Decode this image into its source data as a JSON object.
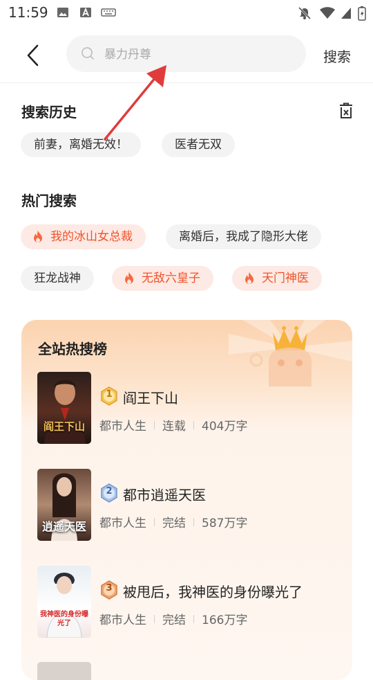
{
  "status_bar": {
    "time": "11:59"
  },
  "header": {
    "search_placeholder": "暴力丹尊",
    "search_button": "搜索"
  },
  "history": {
    "title": "搜索历史",
    "items": [
      "前妻，离婚无效！",
      "医者无双"
    ]
  },
  "hot": {
    "title": "热门搜索",
    "items": [
      {
        "label": "我的冰山女总裁",
        "hot": true
      },
      {
        "label": "离婚后，我成了隐形大佬",
        "hot": false
      },
      {
        "label": "狂龙战神",
        "hot": false
      },
      {
        "label": "无敌六皇子",
        "hot": true
      },
      {
        "label": "天门神医",
        "hot": true
      }
    ]
  },
  "ranking": {
    "title": "全站热搜榜",
    "books": [
      {
        "rank": "1",
        "title": "阎王下山",
        "genre": "都市人生",
        "status": "连载",
        "words": "404万字",
        "cover_text": "阎王下山"
      },
      {
        "rank": "2",
        "title": "都市逍遥天医",
        "genre": "都市人生",
        "status": "完结",
        "words": "587万字",
        "cover_text": "逍遥天医"
      },
      {
        "rank": "3",
        "title": "被甩后，我神医的身份曝光了",
        "genre": "都市人生",
        "status": "完结",
        "words": "166万字",
        "cover_text": "我神医的身份曝光了"
      }
    ]
  },
  "colors": {
    "accent": "#f0532c",
    "hot_chip_bg": "#fdeae4",
    "chip_bg": "#f3f3f3",
    "arrow": "#e03c3c"
  }
}
